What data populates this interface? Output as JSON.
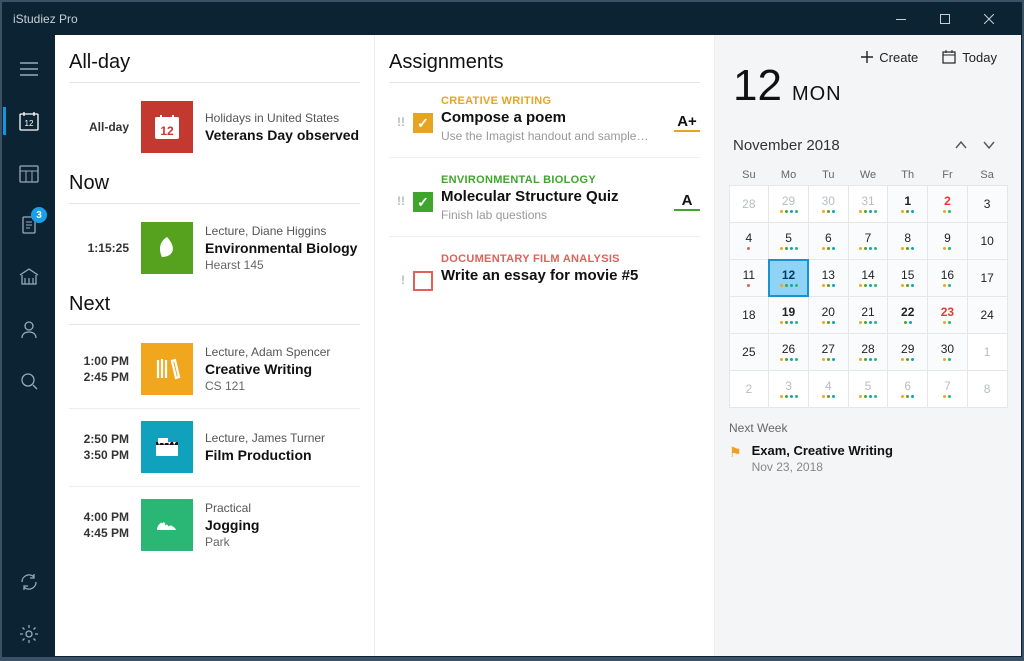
{
  "app": {
    "title": "iStudiez Pro"
  },
  "toolbar": {
    "create": "Create",
    "today": "Today"
  },
  "sidebar": {
    "badge": "3"
  },
  "sections": {
    "allday": "All-day",
    "now": "Now",
    "next": "Next",
    "assignments": "Assignments"
  },
  "allday": {
    "label": "All-day",
    "event": {
      "sub": "Holidays in United States",
      "title": "Veterans Day observed",
      "color": "#c4392f",
      "icon_day": "12"
    }
  },
  "now": {
    "time": "1:15:25",
    "event": {
      "sub": "Lecture, Diane Higgins",
      "title": "Environmental Biology",
      "loc": "Hearst 145",
      "color": "#56a21e"
    }
  },
  "next": [
    {
      "t1": "1:00 PM",
      "t2": "2:45 PM",
      "sub": "Lecture, Adam Spencer",
      "title": "Creative Writing",
      "loc": "CS 121",
      "color": "#f0a71e",
      "icon": "books"
    },
    {
      "t1": "2:50 PM",
      "t2": "3:50 PM",
      "sub": "Lecture, James Turner",
      "title": "Film Production",
      "loc": "",
      "color": "#10a2bd",
      "icon": "film"
    },
    {
      "t1": "4:00 PM",
      "t2": "4:45 PM",
      "sub": "Practical",
      "title": "Jogging",
      "loc": "Park",
      "color": "#2ab776",
      "icon": "shoe"
    }
  ],
  "assignments": [
    {
      "course": "CREATIVE WRITING",
      "ccolor": "#e6a423",
      "title": "Compose a poem",
      "desc": "Use the Imagist handout and sample…",
      "priority": "!!",
      "done": true,
      "grade": "A+",
      "gcolor": "#e6a423"
    },
    {
      "course": "ENVIRONMENTAL BIOLOGY",
      "ccolor": "#3fa52c",
      "title": "Molecular Structure Quiz",
      "desc": "Finish lab questions",
      "priority": "!!",
      "done": true,
      "grade": "A",
      "gcolor": "#3fa52c"
    },
    {
      "course": "DOCUMENTARY FILM ANALYSIS",
      "ccolor": "#e0605a",
      "title": "Write an essay for movie #5",
      "desc": "",
      "priority": "!",
      "done": false,
      "grade": "",
      "gcolor": "#e0605a"
    }
  ],
  "date": {
    "daynum": "12",
    "dow": "MON",
    "month": "November 2018"
  },
  "dow": [
    "Su",
    "Mo",
    "Tu",
    "We",
    "Th",
    "Fr",
    "Sa"
  ],
  "cal": [
    {
      "n": "28",
      "o": true
    },
    {
      "n": "29",
      "o": true,
      "d": [
        "#f0a71e",
        "#56a21e",
        "#10a2bd",
        "#2ab776"
      ]
    },
    {
      "n": "30",
      "o": true,
      "d": [
        "#f0a71e",
        "#56a21e",
        "#10a2bd"
      ]
    },
    {
      "n": "31",
      "o": true,
      "d": [
        "#f0a71e",
        "#56a21e",
        "#10a2bd",
        "#2ab776"
      ]
    },
    {
      "n": "1",
      "b": true,
      "d": [
        "#f0a71e",
        "#56a21e",
        "#10a2bd"
      ]
    },
    {
      "n": "2",
      "r": true,
      "d": [
        "#f0a71e",
        "#2ab776"
      ]
    },
    {
      "n": "3"
    },
    {
      "n": "4",
      "d": [
        "#e0605a"
      ]
    },
    {
      "n": "5",
      "d": [
        "#f0a71e",
        "#56a21e",
        "#10a2bd",
        "#2ab776"
      ]
    },
    {
      "n": "6",
      "d": [
        "#f0a71e",
        "#56a21e",
        "#10a2bd"
      ]
    },
    {
      "n": "7",
      "d": [
        "#f0a71e",
        "#56a21e",
        "#10a2bd",
        "#2ab776"
      ]
    },
    {
      "n": "8",
      "d": [
        "#f0a71e",
        "#56a21e",
        "#10a2bd"
      ]
    },
    {
      "n": "9",
      "d": [
        "#f0a71e",
        "#2ab776"
      ]
    },
    {
      "n": "10"
    },
    {
      "n": "11",
      "d": [
        "#e0605a"
      ]
    },
    {
      "n": "12",
      "today": true,
      "d": [
        "#f0a71e",
        "#56a21e",
        "#10a2bd",
        "#2ab776"
      ]
    },
    {
      "n": "13",
      "d": [
        "#f0a71e",
        "#56a21e",
        "#10a2bd"
      ]
    },
    {
      "n": "14",
      "d": [
        "#f0a71e",
        "#56a21e",
        "#10a2bd",
        "#2ab776"
      ]
    },
    {
      "n": "15",
      "d": [
        "#f0a71e",
        "#56a21e",
        "#10a2bd"
      ]
    },
    {
      "n": "16",
      "d": [
        "#f0a71e",
        "#2ab776"
      ]
    },
    {
      "n": "17"
    },
    {
      "n": "18"
    },
    {
      "n": "19",
      "b": true,
      "d": [
        "#f0a71e",
        "#56a21e",
        "#10a2bd",
        "#2ab776"
      ]
    },
    {
      "n": "20",
      "d": [
        "#f0a71e",
        "#56a21e",
        "#10a2bd"
      ]
    },
    {
      "n": "21",
      "d": [
        "#f0a71e",
        "#56a21e",
        "#10a2bd",
        "#2ab776"
      ]
    },
    {
      "n": "22",
      "b": true,
      "d": [
        "#56a21e",
        "#10a2bd"
      ]
    },
    {
      "n": "23",
      "r": true,
      "d": [
        "#f0a71e",
        "#2ab776"
      ]
    },
    {
      "n": "24"
    },
    {
      "n": "25"
    },
    {
      "n": "26",
      "d": [
        "#f0a71e",
        "#56a21e",
        "#10a2bd",
        "#2ab776"
      ]
    },
    {
      "n": "27",
      "d": [
        "#f0a71e",
        "#56a21e",
        "#10a2bd"
      ]
    },
    {
      "n": "28",
      "d": [
        "#f0a71e",
        "#56a21e",
        "#10a2bd",
        "#2ab776"
      ]
    },
    {
      "n": "29",
      "d": [
        "#f0a71e",
        "#56a21e",
        "#10a2bd"
      ]
    },
    {
      "n": "30",
      "d": [
        "#f0a71e",
        "#2ab776"
      ]
    },
    {
      "n": "1",
      "o": true
    },
    {
      "n": "2",
      "o": true
    },
    {
      "n": "3",
      "o": true,
      "d": [
        "#f0a71e",
        "#56a21e",
        "#10a2bd",
        "#2ab776"
      ]
    },
    {
      "n": "4",
      "o": true,
      "d": [
        "#f0a71e",
        "#56a21e",
        "#10a2bd"
      ]
    },
    {
      "n": "5",
      "o": true,
      "d": [
        "#f0a71e",
        "#56a21e",
        "#10a2bd",
        "#2ab776"
      ]
    },
    {
      "n": "6",
      "o": true,
      "d": [
        "#f0a71e",
        "#56a21e",
        "#10a2bd"
      ]
    },
    {
      "n": "7",
      "o": true,
      "d": [
        "#f0a71e",
        "#2ab776"
      ]
    },
    {
      "n": "8",
      "o": true
    }
  ],
  "nextweek": {
    "header": "Next Week",
    "title": "Exam, Creative Writing",
    "date": "Nov 23, 2018"
  }
}
